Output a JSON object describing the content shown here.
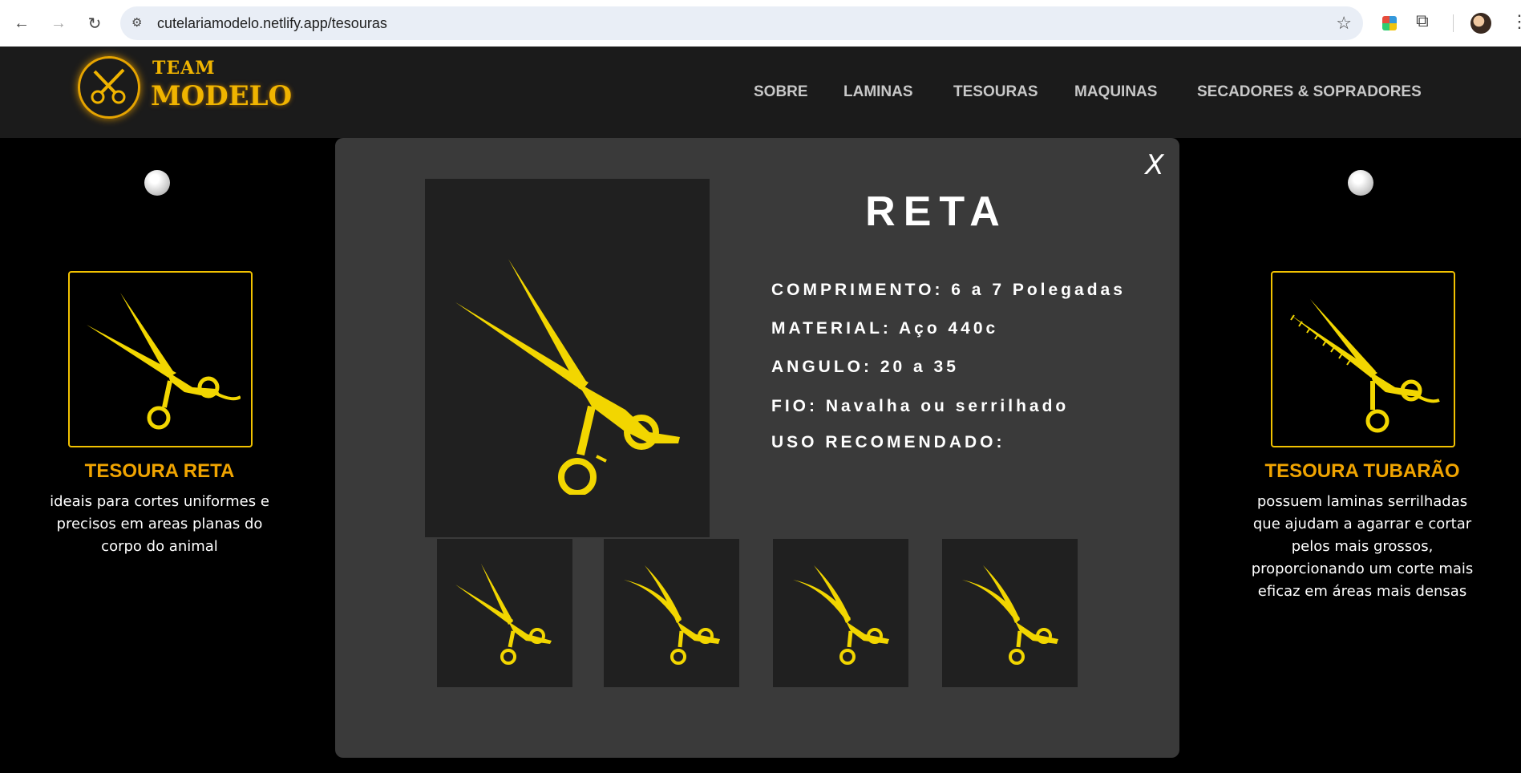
{
  "browser": {
    "url": "cutelariamodelo.netlify.app/tesouras",
    "back_icon": "arrow-left-icon",
    "forward_icon": "arrow-right-icon",
    "reload_icon": "reload-icon"
  },
  "header": {
    "logo_line1": "TEAM",
    "logo_line2": "MODELO",
    "menu": [
      "SOBRE",
      "LAMINAS",
      "TESOURAS",
      "MAQUINAS",
      "SECADORES & SOPRADORES"
    ]
  },
  "cards": {
    "left": {
      "title": "TESOURA RETA",
      "description": "ideais para cortes uniformes e precisos em areas planas do corpo do animal"
    },
    "right": {
      "title": "TESOURA TUBARÃO",
      "description": "possuem laminas serrilhadas que ajudam a agarrar e cortar pelos mais grossos, proporcionando um corte mais eficaz em áreas mais densas"
    }
  },
  "modal": {
    "close_label": "X",
    "title": "RETA",
    "specs": [
      {
        "label": "COMPRIMENTO:",
        "value": "6 a 7 Polegadas"
      },
      {
        "label": "MATERIAL:",
        "value": "Aço 440c"
      },
      {
        "label": "ANGULO:",
        "value": "20 a 35"
      },
      {
        "label": "FIO:",
        "value": "Navalha ou serrilhado"
      },
      {
        "label": "USO RECOMENDADO:",
        "value": ""
      }
    ],
    "thumbnails": [
      "straight-scissors",
      "curved-scissors",
      "curved-scissors",
      "curved-scissors"
    ]
  },
  "colors": {
    "accent_yellow": "#f2d600",
    "accent_orange": "#f0a400",
    "modal_bg": "#3a3a3a",
    "panel_bg": "#202020"
  }
}
